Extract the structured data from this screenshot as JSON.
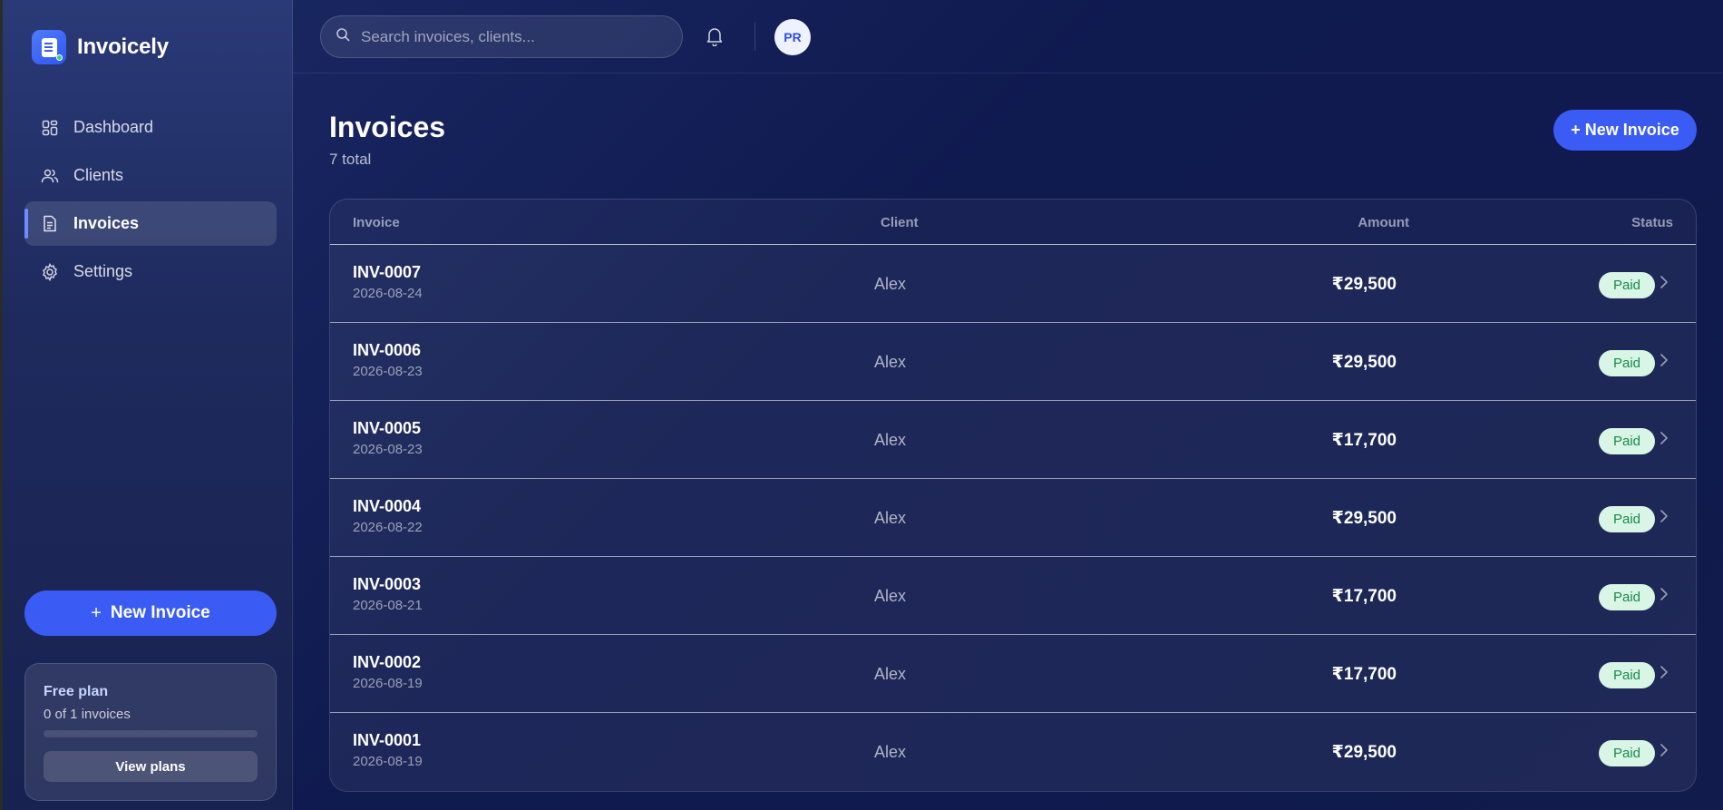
{
  "brand": {
    "name": "Invoicely"
  },
  "sidebar": {
    "items": [
      {
        "label": "Dashboard",
        "icon": "grid-icon"
      },
      {
        "label": "Clients",
        "icon": "users-icon"
      },
      {
        "label": "Invoices",
        "icon": "document-icon",
        "active": true
      },
      {
        "label": "Settings",
        "icon": "gear-icon"
      }
    ],
    "new_invoice": {
      "plus": "+",
      "label": "New Invoice"
    },
    "plan": {
      "title": "Free plan",
      "usage": "0 of 1 invoices",
      "progress": 0,
      "button": "View plans"
    }
  },
  "topbar": {
    "search_placeholder": "Search invoices, clients...",
    "avatar_initials": "PR"
  },
  "main": {
    "title": "Invoices",
    "subtitle": "7 total",
    "new_invoice_label": "+ New Invoice",
    "table": {
      "headers": {
        "invoice": "Invoice",
        "client": "Client",
        "amount": "Amount",
        "status": "Status"
      },
      "rows": [
        {
          "id": "INV-0007",
          "date": "2026-08-24",
          "client": "Alex",
          "amount": "₹29,500",
          "status": "Paid"
        },
        {
          "id": "INV-0006",
          "date": "2026-08-23",
          "client": "Alex",
          "amount": "₹29,500",
          "status": "Paid"
        },
        {
          "id": "INV-0005",
          "date": "2026-08-23",
          "client": "Alex",
          "amount": "₹17,700",
          "status": "Paid"
        },
        {
          "id": "INV-0004",
          "date": "2026-08-22",
          "client": "Alex",
          "amount": "₹29,500",
          "status": "Paid"
        },
        {
          "id": "INV-0003",
          "date": "2026-08-21",
          "client": "Alex",
          "amount": "₹17,700",
          "status": "Paid"
        },
        {
          "id": "INV-0002",
          "date": "2026-08-19",
          "client": "Alex",
          "amount": "₹17,700",
          "status": "Paid"
        },
        {
          "id": "INV-0001",
          "date": "2026-08-19",
          "client": "Alex",
          "amount": "₹29,500",
          "status": "Paid"
        }
      ]
    }
  },
  "colors": {
    "accent": "#3a5cf5",
    "paid_badge_bg": "#d9f5e6",
    "paid_badge_text": "#178a4e"
  }
}
